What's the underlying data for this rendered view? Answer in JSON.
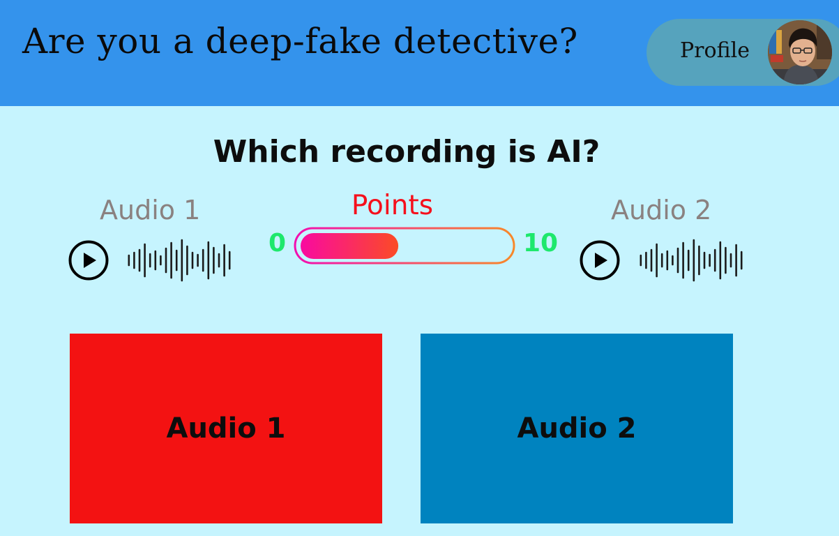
{
  "header": {
    "title": "Are you a deep-fake detective?",
    "profile_label": "Profile"
  },
  "question": "Which recording is AI?",
  "players": [
    {
      "label": "Audio 1",
      "play_icon": "play-icon",
      "waveform_icon": "waveform-icon"
    },
    {
      "label": "Audio 2",
      "play_icon": "play-icon",
      "waveform_icon": "waveform-icon"
    }
  ],
  "points": {
    "label": "Points",
    "min": "0",
    "max": "10",
    "value_fraction": 0.47
  },
  "answers": [
    {
      "label": "Audio 1",
      "color": "#f31212"
    },
    {
      "label": "Audio 2",
      "color": "#0083bf"
    }
  ],
  "colors": {
    "header_bg": "#3493ec",
    "page_bg": "#c6f4fe",
    "profile_pill": "#56a3bd",
    "points_label": "#f5101c",
    "range_numbers": "#1ee86c",
    "progress_gradient_start": "#f90aa0",
    "progress_gradient_end": "#fb4b26"
  }
}
